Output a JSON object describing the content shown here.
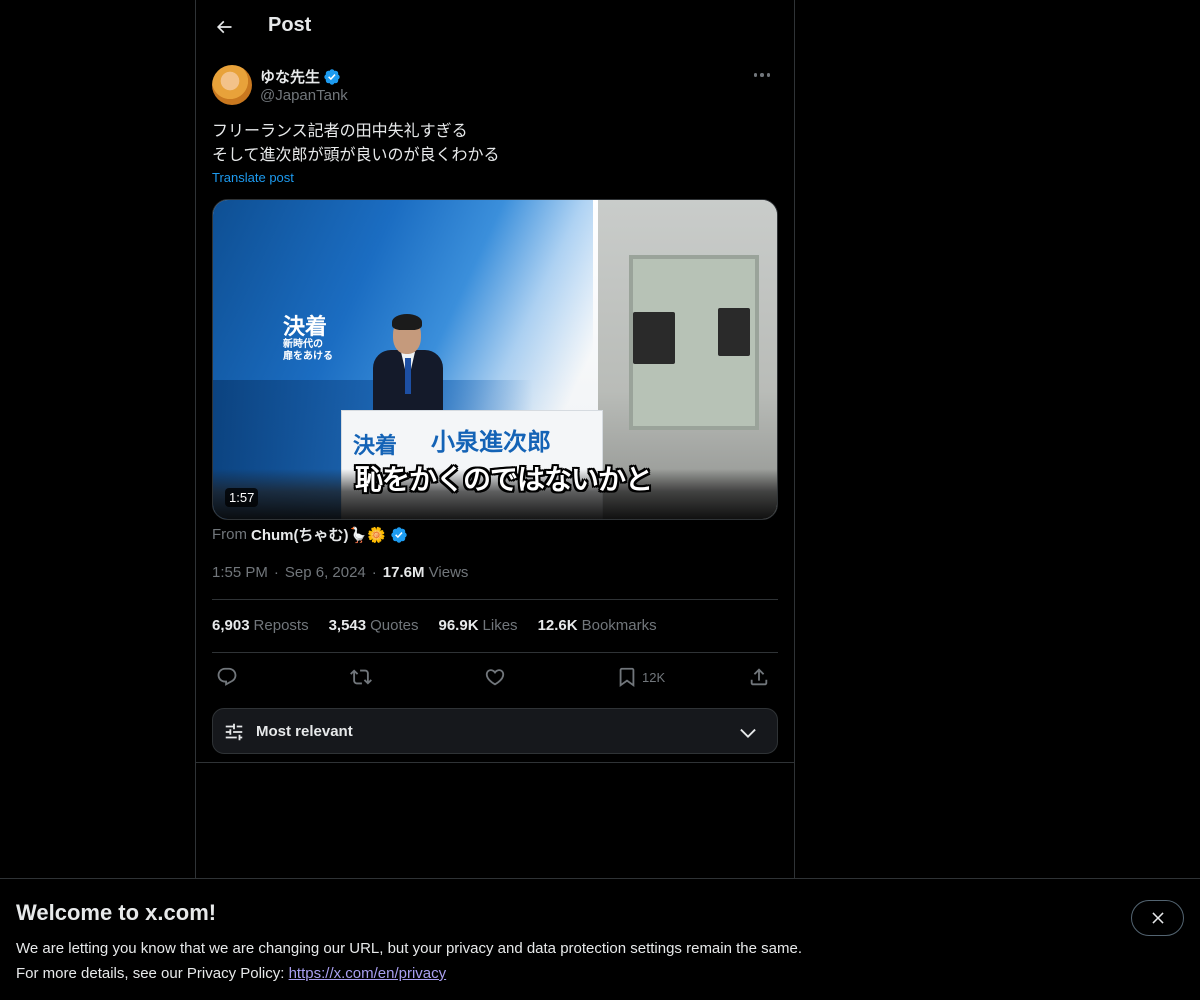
{
  "header": {
    "title": "Post",
    "back_icon": "arrow-left-icon"
  },
  "author": {
    "name": "ゆな先生",
    "handle": "@JapanTank",
    "verified": true,
    "verified_color": "#1d9bf0"
  },
  "post": {
    "text": "フリーランス記者の田中失礼すぎる\nそして進次郎が頭が良いのが良くわかる",
    "translate_label": "Translate post",
    "video": {
      "slogan_main": "決着",
      "slogan_sub_1": "新時代の",
      "slogan_sub_2": "扉をあける",
      "podium_left": "決着",
      "podium_right": "小泉進次郎",
      "subtitle": "恥をかくのではないかと",
      "duration": "1:57"
    },
    "source": {
      "prefix": "From",
      "name": "Chum(ちゃむ)🪿🌼"
    },
    "time": "1:55 PM",
    "date": "Sep 6, 2024",
    "views_count": "17.6M",
    "views_label": "Views",
    "dot": "·"
  },
  "stats": [
    {
      "num": "6,903",
      "label": "Reposts"
    },
    {
      "num": "3,543",
      "label": "Quotes"
    },
    {
      "num": "96.9K",
      "label": "Likes"
    },
    {
      "num": "12.6K",
      "label": "Bookmarks"
    }
  ],
  "actions": {
    "reply_icon": "reply-icon",
    "repost_icon": "repost-icon",
    "like_icon": "heart-icon",
    "bookmark_icon": "bookmark-icon",
    "bookmark_count": "12K",
    "share_icon": "share-icon"
  },
  "sort": {
    "label": "Most relevant"
  },
  "banner": {
    "title": "Welcome to x.com!",
    "line1": "We are letting you know that we are changing our URL, but your privacy and data protection settings remain the same.",
    "line2_prefix": "For more details, see our Privacy Policy: ",
    "link": "https://x.com/en/privacy",
    "close_icon": "close-icon"
  },
  "colors": {
    "background": "#000000",
    "text": "#e7e9ea",
    "secondary": "#71767b",
    "accent": "#1d9bf0",
    "border": "#2f3336",
    "link_purple": "#a99ff0"
  }
}
